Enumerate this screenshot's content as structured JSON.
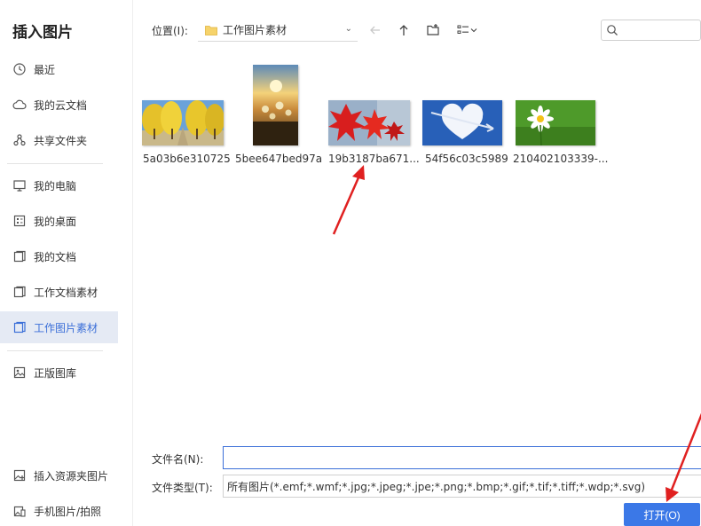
{
  "dialog": {
    "title": "插入图片"
  },
  "sidebar": {
    "items": [
      {
        "label": "最近",
        "icon": "clock-icon"
      },
      {
        "label": "我的云文档",
        "icon": "cloud-icon"
      },
      {
        "label": "共享文件夹",
        "icon": "share-icon"
      },
      {
        "label": "我的电脑",
        "icon": "computer-icon"
      },
      {
        "label": "我的桌面",
        "icon": "desktop-icon"
      },
      {
        "label": "我的文档",
        "icon": "folder-icon"
      },
      {
        "label": "工作文档素材",
        "icon": "folder-icon"
      },
      {
        "label": "工作图片素材",
        "icon": "folder-icon",
        "active": true
      },
      {
        "label": "正版图库",
        "icon": "gallery-icon"
      },
      {
        "label": "插入资源夹图片",
        "icon": "resource-icon"
      },
      {
        "label": "手机图片/拍照",
        "icon": "phone-image-icon"
      }
    ]
  },
  "toolbar": {
    "location_label": "位置(I):",
    "path": "工作图片素材",
    "search_placeholder": ""
  },
  "files": [
    {
      "name": "5a03b6e310725",
      "scene": "yellow ginkgo trees"
    },
    {
      "name": "5bee647bed97a",
      "scene": "sunset flowers"
    },
    {
      "name": "19b3187ba671...",
      "scene": "red maple leaves"
    },
    {
      "name": "54f56c03c5989",
      "scene": "heart cloud"
    },
    {
      "name": "210402103339-...",
      "scene": "white daisy"
    }
  ],
  "form": {
    "filename_label": "文件名(N):",
    "filename_value": "",
    "filetype_label": "文件类型(T):",
    "filetype_value": "所有图片(*.emf;*.wmf;*.jpg;*.jpeg;*.jpe;*.png;*.bmp;*.gif;*.tif;*.tiff;*.wdp;*.svg)",
    "open_button": "打开(O)"
  },
  "colors": {
    "accent": "#3b78e7",
    "active_bg": "#e5eaf4",
    "active_text": "#3b6fd8",
    "annotation_arrow": "#e02020"
  }
}
